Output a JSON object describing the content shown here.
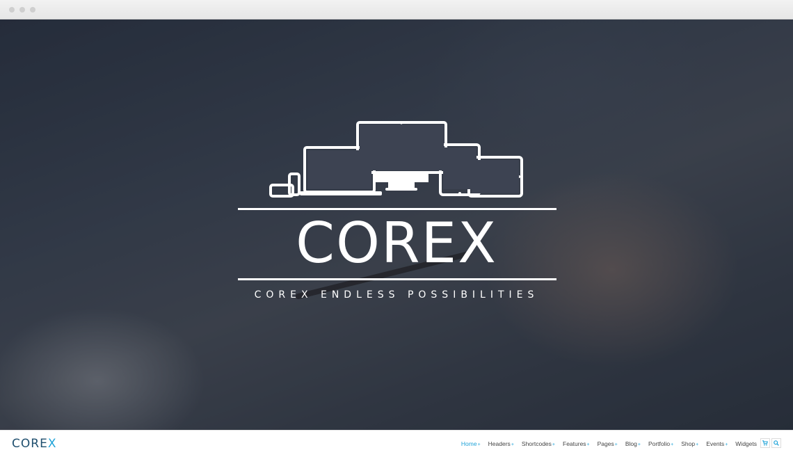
{
  "hero": {
    "brand": "COREX",
    "tagline": "COREX ENDLESS POSSIBILITIES"
  },
  "navbar": {
    "logo_text": "CORE",
    "logo_accent": "X",
    "menu": [
      {
        "label": "Home",
        "active": true
      },
      {
        "label": "Headers"
      },
      {
        "label": "Shortcodes"
      },
      {
        "label": "Features"
      },
      {
        "label": "Pages"
      },
      {
        "label": "Blog"
      },
      {
        "label": "Portfolio"
      },
      {
        "label": "Shop"
      },
      {
        "label": "Events"
      },
      {
        "label": "Widgets"
      }
    ],
    "plus_glyph": "+",
    "cart_icon": "cart-icon",
    "search_icon": "search-icon"
  },
  "colors": {
    "accent": "#1fa3d8",
    "logo_dark": "#1f4f6e",
    "menu_text": "#444444"
  }
}
